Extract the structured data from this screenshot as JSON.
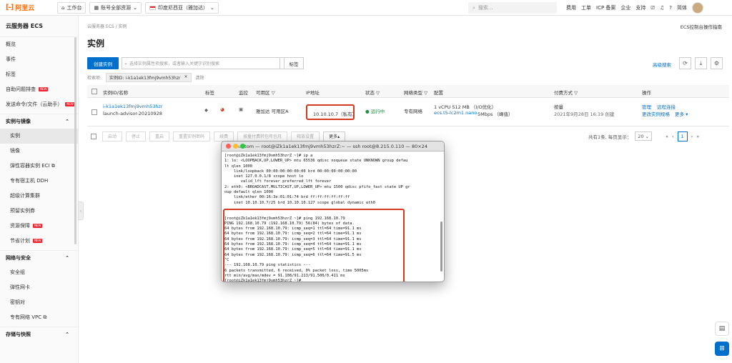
{
  "topbar": {
    "logo_mark": "[-]",
    "logo_text": "阿里云",
    "workbench": "工作台",
    "account": "账号全部资源",
    "region": "印度尼西亚（雅加达）",
    "search_placeholder": "搜索...",
    "links": [
      "费用",
      "工单",
      "ICP 备案",
      "企业",
      "支持"
    ],
    "user": "简体"
  },
  "sidebar": {
    "title": "云服务器 ECS",
    "top_items": [
      {
        "label": "概览",
        "new": false
      },
      {
        "label": "事件",
        "new": false
      },
      {
        "label": "标签",
        "new": false
      },
      {
        "label": "自助问题排查",
        "new": true
      },
      {
        "label": "发送命令/文件（云助手）",
        "new": true
      }
    ],
    "group1": "实例与镜像",
    "group1_items": [
      {
        "label": "实例",
        "new": false,
        "active": true
      },
      {
        "label": "镜像",
        "new": false
      },
      {
        "label": "弹性容器实例 ECI ⧉",
        "new": false
      },
      {
        "label": "专有宿主机 DDH",
        "new": false
      },
      {
        "label": "超级计算集群",
        "new": false
      },
      {
        "label": "预留实例券",
        "new": false
      },
      {
        "label": "资源保障",
        "new": true
      },
      {
        "label": "节省计划",
        "new": true
      }
    ],
    "group2": "网络与安全",
    "group2_items": [
      {
        "label": "安全组"
      },
      {
        "label": "弹性网卡"
      },
      {
        "label": "密钥对"
      },
      {
        "label": "专有网络 VPC ⧉"
      }
    ],
    "group3": "存储与快照",
    "new_badge": "NEW"
  },
  "main": {
    "breadcrumb": "云服务器 ECS  /  实例",
    "guide_link": "ECS控制台操作指南",
    "title": "实例",
    "create_btn": "创建实例",
    "search_placeholder": "选择实例属性项搜索，或者输入关键字识别搜索",
    "tag_btn": "标签",
    "adv_search": "高级搜索",
    "filter_label": "检索项:",
    "filter_chip": "实例ID: i-k1a1ek13fmj9vmh53hzr",
    "filter_clear": "清除"
  },
  "table": {
    "headers": [
      "实例ID/名称",
      "标签",
      "监控",
      "可用区 ▽",
      "IP地址",
      "状态 ▽",
      "网络类型 ▽",
      "配置",
      "付费方式 ▽",
      "操作"
    ],
    "row": {
      "id": "i-k1a1ek13fmj9vmh53hzr",
      "name": "launch-advisor-20210928",
      "zone": "雅加达 可用区A",
      "ip": "10.10.10.7（私有）",
      "status": "运行中",
      "network": "专有网络",
      "config1": "1 vCPU 512 MB （I/O优化）",
      "config2": "ecs.t5-lc2m1.nano",
      "config3": "5Mbps （峰值）",
      "pay1": "按量",
      "pay2": "2021年9月28日 16:19 创建",
      "op1": "管理",
      "op2": "远程连接",
      "op3": "更改实例规格",
      "op4": "更多 ▾"
    }
  },
  "bulk": {
    "buttons": [
      "启动",
      "停止",
      "重启",
      "重置实例密码",
      "续费",
      "按量付费转包年包月",
      "释放设置"
    ],
    "more": "更多▴"
  },
  "pager": {
    "summary": "共有1条, 每页显示：",
    "page_size": "20",
    "current": "1"
  },
  "terminal": {
    "title": "tom — root@iZk1a1ek13fmj9vmh53hzrZ:~ — ssh root@8.215.0.110 — 80×24",
    "lines": [
      "[root@iZk1a1ek13fmj9vmh53hzrZ ~]# ip a",
      "1: lo: <LOOPBACK,UP,LOWER_UP> mtu 65536 qdisc noqueue state UNKNOWN group defau",
      "lt qlen 1000",
      "    link/loopback 00:00:00:00:00:00 brd 00:00:00:00:00:00",
      "    inet 127.0.0.1/8 scope host lo",
      "       valid_lft forever preferred_lft forever",
      "2: eth0: <BROADCAST,MULTICAST,UP,LOWER_UP> mtu 1500 qdisc pfifo_fast state UP gr",
      "oup default qlen 1000",
      "    link/ether 00:16:3e:01:01:74 brd ff:ff:ff:ff:ff:ff",
      "    inet 10.10.10.7/25 brd 10.10.10.127 scope global dynamic eth0",
      "",
      "",
      "[root@iZk1a1ek13fmj9vmh53hzrZ ~]# ping 192.168.10.79",
      "PING 192.168.10.79 (192.168.10.79) 56(84) bytes of data.",
      "64 bytes from 192.168.10.79: icmp_seq=1 ttl=64 time=91.1 ms",
      "64 bytes from 192.168.10.79: icmp_seq=2 ttl=64 time=91.1 ms",
      "64 bytes from 192.168.10.79: icmp_seq=3 ttl=64 time=91.1 ms",
      "64 bytes from 192.168.10.79: icmp_seq=4 ttl=64 time=91.1 ms",
      "64 bytes from 192.168.10.79: icmp_seq=5 ttl=64 time=91.1 ms",
      "64 bytes from 192.168.10.79: icmp_seq=6 ttl=64 time=91.5 ms",
      "^C",
      "--- 192.168.10.79 ping statistics ---",
      "6 packets transmitted, 6 received, 0% packet loss, time 5005ms",
      "rtt min/avg/max/mdev = 91.108/91.213/91.500/0.411 ms",
      "[root@iZk1a1ek13fmj9vmh53hzrZ ~]# "
    ]
  },
  "colors": {
    "brand": "#ff6a00",
    "primary": "#0070cc",
    "highlight": "#d4381f",
    "running": "#1e8e3e"
  }
}
